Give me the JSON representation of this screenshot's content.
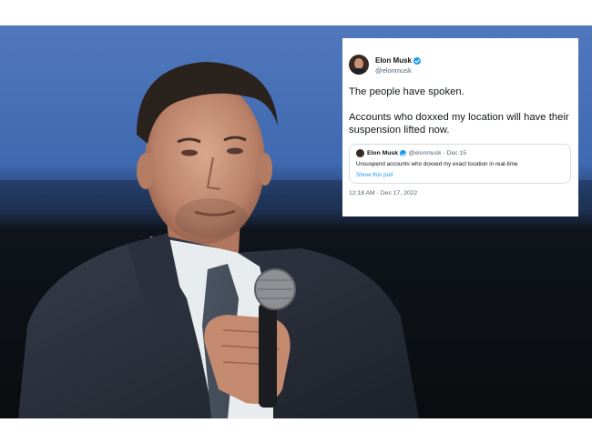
{
  "photo": {
    "description_colors": {
      "backdrop_top": "#3f69b0",
      "backdrop_bottom": "#0d0f12",
      "suit": "#2a2f3b"
    }
  },
  "tweet": {
    "author_name": "Elon Musk",
    "author_handle": "@elonmusk",
    "text_line1": "The people have spoken.",
    "text_line2": "Accounts who doxxed my location will have their suspension lifted now.",
    "timestamp": "12:18 AM · Dec 17, 2022",
    "quote": {
      "author_name": "Elon Musk",
      "meta": "@elonmusk · Dec 15",
      "text": "Unsuspend accounts who doxxed my exact location in real-time",
      "link": "Show this poll"
    }
  }
}
